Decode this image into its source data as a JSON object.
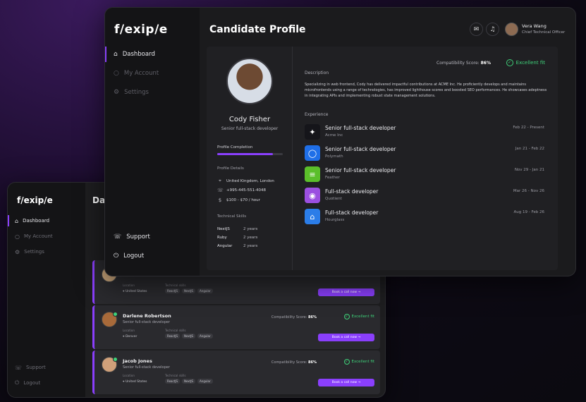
{
  "back": {
    "logo": "f/exip/e",
    "title_partial": "Das",
    "nav": [
      {
        "label": "Dashboard",
        "icon": "home-icon"
      },
      {
        "label": "My Account",
        "icon": "user-icon"
      },
      {
        "label": "Settings",
        "icon": "gear-icon"
      }
    ],
    "support": "Support",
    "logout": "Logout",
    "cards": [
      {
        "name": "",
        "role": "",
        "score_label": "",
        "score": "",
        "fit": "",
        "location_label": "Location",
        "location": "United States",
        "skills_label": "Technical skills",
        "skills": [
          "ReactJS",
          "NextJS",
          "Angular"
        ],
        "book": "Book a call now →"
      },
      {
        "name": "Darlene Robertson",
        "role": "Senior full-stack developer",
        "score_label": "Compatibility Score:",
        "score": "86%",
        "fit": "Excellent fit",
        "location_label": "Location",
        "location": "Denver",
        "skills_label": "Technical skills",
        "skills": [
          "ReactJS",
          "NextJS",
          "Angular"
        ],
        "book": "Book a call now →"
      },
      {
        "name": "Jacob Jones",
        "role": "Senior full-stack developer",
        "score_label": "Compatibility Score:",
        "score": "86%",
        "fit": "Excellent fit",
        "location_label": "Location",
        "location": "United States",
        "skills_label": "Technical skills",
        "skills": [
          "ReactJS",
          "NextJS",
          "Angular"
        ],
        "book": "Book a call now →"
      }
    ]
  },
  "front": {
    "logo": "f/exip/e",
    "nav": [
      {
        "label": "Dashboard",
        "icon": "home-icon"
      },
      {
        "label": "My Account",
        "icon": "user-icon"
      },
      {
        "label": "Settings",
        "icon": "gear-icon"
      }
    ],
    "support": "Support",
    "logout": "Logout",
    "page_title": "Candidate Profile",
    "user": {
      "name": "Vera Wang",
      "role": "Chief Technical Officer"
    },
    "candidate": {
      "name": "Cody Fisher",
      "role": "Senior full-stack developer",
      "profile_completion_label": "Profile Completion",
      "profile_completion": 0.85,
      "details_label": "Profile Details",
      "location": "United Kingdom, London",
      "phone": "+995-445-551-4048",
      "rate": "$100 - $70 / hour",
      "skills_label": "Technical Skills",
      "skills": [
        {
          "name": "NextJS",
          "years": "2 years"
        },
        {
          "name": "Ruby",
          "years": "2 years"
        },
        {
          "name": "Angular",
          "years": "2 years"
        }
      ]
    },
    "score_label": "Compatibility Score:",
    "score": "86%",
    "fit": "Excellent fit",
    "description_label": "Description",
    "description": "Specializing in web frontend, Cody has delivered impactful contributions at ACME Inc. He proficiently develops and maintains microfrontends using a range of technologies, has improved lighthouse scores and boosted SEO performances. He showcases adeptness in integrating APIs and implementing robust state management solutions.",
    "experience_label": "Experience",
    "experience": [
      {
        "title": "Senior full-stack developer",
        "company": "Acme Inc",
        "dates": "Feb 22 - Present",
        "color": "#15151a",
        "glyph": "✦"
      },
      {
        "title": "Senior full-stack developer",
        "company": "Polymath",
        "dates": "Jan 21 - Feb 22",
        "color": "#1f6fe8",
        "glyph": "◯"
      },
      {
        "title": "Senior full-stack developer",
        "company": "Feather",
        "dates": "Nov 29 - Jan 21",
        "color": "#5bbf2a",
        "glyph": "≡"
      },
      {
        "title": "Full-stack developer",
        "company": "Quotient",
        "dates": "Mar 26 - Nov 26",
        "color": "#9b4fe0",
        "glyph": "◉"
      },
      {
        "title": "Full-stack developer",
        "company": "Hourglass",
        "dates": "Aug 19 - Feb 26",
        "color": "#2b7de8",
        "glyph": "⌂"
      }
    ]
  }
}
